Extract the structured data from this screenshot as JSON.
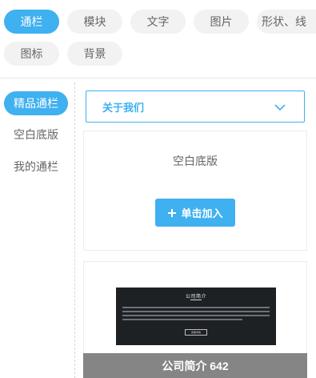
{
  "categories": [
    {
      "label": "通栏",
      "active": true
    },
    {
      "label": "模块",
      "active": false
    },
    {
      "label": "文字",
      "active": false
    },
    {
      "label": "图片",
      "active": false
    },
    {
      "label": "形状、线",
      "active": false
    },
    {
      "label": "图标",
      "active": false
    },
    {
      "label": "背景",
      "active": false
    }
  ],
  "sidebar": {
    "items": [
      {
        "label": "精品通栏",
        "active": true
      },
      {
        "label": "空白底版",
        "active": false
      },
      {
        "label": "我的通栏",
        "active": false
      }
    ]
  },
  "dropdown": {
    "selected": "关于我们",
    "icon": "chevron-down-icon"
  },
  "blank_card": {
    "title": "空白底版",
    "add_button": "单击加入",
    "add_icon": "plus-icon"
  },
  "template_card": {
    "thumbnail_title": "公司简介",
    "thumbnail_button": "查看详情",
    "caption": "公司简介 642"
  },
  "colors": {
    "accent": "#3fb0f0",
    "pill_bg": "#f2f2f2",
    "caption_bg": "#858585",
    "thumbnail_bg": "#1e2124"
  }
}
